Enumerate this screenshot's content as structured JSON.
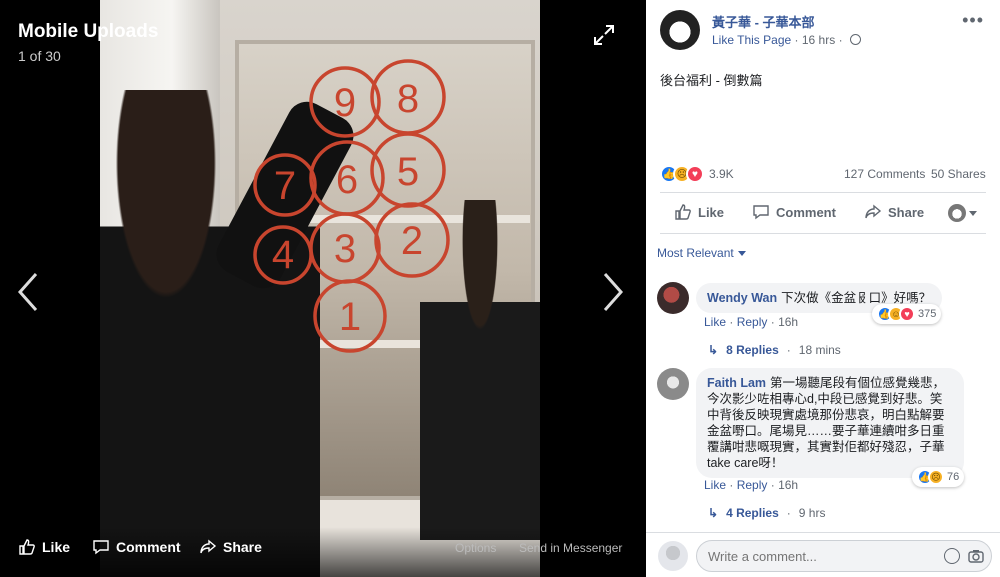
{
  "viewer": {
    "album_title": "Mobile Uploads",
    "position": "1 of 30",
    "mirror_numbers": [
      "8",
      "9",
      "6",
      "5",
      "7",
      "3",
      "4",
      "2",
      "1"
    ],
    "bottom": {
      "like": "Like",
      "comment": "Comment",
      "share": "Share",
      "options": "Options",
      "send": "Send in Messenger"
    }
  },
  "post": {
    "page_name": "黃子華 - 子華本部",
    "like_page": "Like This Page",
    "time": "16 hrs",
    "text": "後台福利 - 倒數篇",
    "reactions_count": "3.9K",
    "comments_count": "127 Comments",
    "shares_count": "50 Shares",
    "actions": {
      "like": "Like",
      "comment": "Comment",
      "share": "Share"
    },
    "sort_label": "Most Relevant"
  },
  "comments": [
    {
      "author": "Wendy Wan",
      "text": "下次做《金盆𠬝口》好嗎？",
      "like": "Like",
      "reply": "Reply",
      "time": "16h",
      "reactions": "375",
      "replies_label": "8 Replies",
      "replies_time": "18 mins"
    },
    {
      "author": "Faith Lam",
      "text_lines": [
        "第一場聽尾段有個位感覺幾悲，",
        "今次影少咗相專心d,中段已感覺到好悲。笑",
        "中背後反映現實處境那份悲哀，明白點解要",
        "金盆嘢口。尾場見……要子華連續咁多日重",
        "覆講咁悲嘅現實，其實對佢都好殘忍，子華",
        "take care呀！"
      ],
      "like": "Like",
      "reply": "Reply",
      "time": "16h",
      "reactions": "76",
      "replies_label": "4 Replies",
      "replies_time": "9 hrs"
    }
  ],
  "composer": {
    "placeholder": "Write a comment..."
  }
}
